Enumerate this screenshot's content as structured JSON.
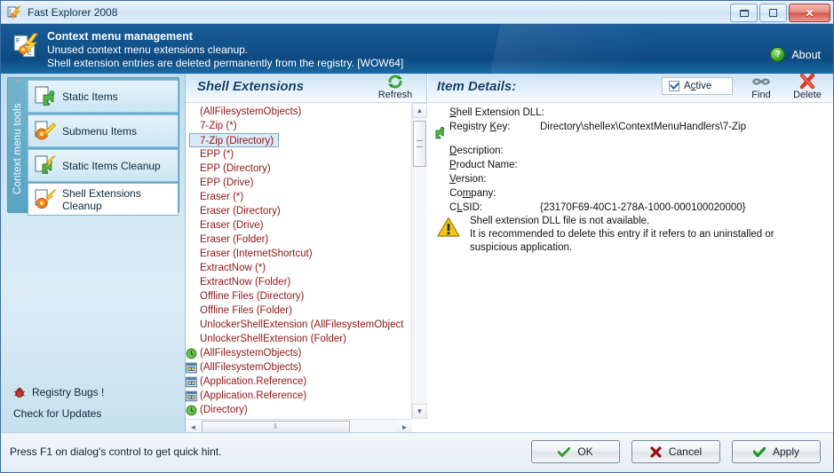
{
  "window": {
    "title": "Fast Explorer 2008",
    "app_icon": "lightning-app-icon",
    "minimize_label": "Minimize",
    "maximize_label": "Maximize",
    "close_label": "Close"
  },
  "banner": {
    "heading": "Context menu management",
    "line2": "Unused context menu extensions cleanup.",
    "line3": "Shell extension entries are deleted permanently from the registry. [WOW64]",
    "about_label": "About",
    "about_icon": "question-mark-icon"
  },
  "sidebar": {
    "group_label": "Context menu tools",
    "collapse_icon": "chevron-up-icon",
    "items": [
      {
        "label": "Static Items",
        "icon": "green-puzzle-icon",
        "selected": false
      },
      {
        "label": "Submenu Items",
        "icon": "orange-gear-wand-icon",
        "selected": false
      },
      {
        "label": "Static Items Cleanup",
        "icon": "green-puzzle-bolt-icon",
        "selected": false
      },
      {
        "label": "Shell Extensions Cleanup",
        "icon": "gear-bolt-icon",
        "selected": true
      }
    ],
    "registry_bugs_label": "Registry Bugs !",
    "registry_bugs_icon": "bug-icon",
    "check_updates_label": "Check for Updates"
  },
  "list_panel": {
    "title": "Shell Extensions",
    "refresh_label": "Refresh",
    "refresh_icon": "refresh-arrows-icon",
    "items": [
      {
        "label": "(AllFilesystemObjects)",
        "icon": null,
        "selected": false
      },
      {
        "label": "7-Zip (*)",
        "icon": null,
        "selected": false
      },
      {
        "label": "7-Zip (Directory)",
        "icon": null,
        "selected": true
      },
      {
        "label": "EPP (*)",
        "icon": null,
        "selected": false
      },
      {
        "label": "EPP (Directory)",
        "icon": null,
        "selected": false
      },
      {
        "label": "EPP (Drive)",
        "icon": null,
        "selected": false
      },
      {
        "label": "Eraser (*)",
        "icon": null,
        "selected": false
      },
      {
        "label": "Eraser (Directory)",
        "icon": null,
        "selected": false
      },
      {
        "label": "Eraser (Drive)",
        "icon": null,
        "selected": false
      },
      {
        "label": "Eraser (Folder)",
        "icon": null,
        "selected": false
      },
      {
        "label": "Eraser (InternetShortcut)",
        "icon": null,
        "selected": false
      },
      {
        "label": "ExtractNow (*)",
        "icon": null,
        "selected": false
      },
      {
        "label": "ExtractNow (Folder)",
        "icon": null,
        "selected": false
      },
      {
        "label": "Offline Files (Directory)",
        "icon": null,
        "selected": false
      },
      {
        "label": "Offline Files (Folder)",
        "icon": null,
        "selected": false
      },
      {
        "label": "UnlockerShellExtension (AllFilesystemObject",
        "icon": null,
        "selected": false
      },
      {
        "label": "UnlockerShellExtension (Folder)",
        "icon": null,
        "selected": false
      },
      {
        "label": "(AllFilesystemObjects)",
        "icon": "green-clock-icon",
        "selected": false
      },
      {
        "label": "(AllFilesystemObjects)",
        "icon": "blue-window-icon",
        "selected": false
      },
      {
        "label": "(Application.Reference)",
        "icon": "blue-window-icon",
        "selected": false
      },
      {
        "label": "(Application.Reference)",
        "icon": "blue-window-icon",
        "selected": false
      },
      {
        "label": "(Directory)",
        "icon": "green-clock-icon",
        "selected": false
      }
    ],
    "vscroll_up_icon": "triangle-up-icon",
    "vscroll_down_icon": "triangle-down-icon",
    "hscroll_left_icon": "triangle-left-icon",
    "hscroll_right_icon": "triangle-right-icon"
  },
  "details": {
    "title": "Item Details:",
    "active_label": "Active",
    "active_checked": true,
    "find_label": "Find",
    "find_icon": "binoculars-icon",
    "delete_label": "Delete",
    "delete_icon": "red-x-icon",
    "item_icon": "green-puzzle-icon",
    "fields": [
      {
        "label": "Shell Extension DLL:",
        "accel": "S",
        "value": ""
      },
      {
        "label": "Registry Key:",
        "accel": "K",
        "value": "Directory\\shellex\\ContextMenuHandlers\\7-Zip"
      },
      {
        "label": "Description:",
        "accel": "D",
        "value": ""
      },
      {
        "label": "Product Name:",
        "accel": "P",
        "value": ""
      },
      {
        "label": "Version:",
        "accel": "V",
        "value": ""
      },
      {
        "label": "Company:",
        "accel": "m",
        "value": ""
      },
      {
        "label": "CLSID:",
        "accel": "L",
        "value": "{23170F69-40C1-278A-1000-000100020000}"
      }
    ],
    "warning_icon": "warning-triangle-icon",
    "warning_line1": "Shell extension DLL file is not available.",
    "warning_line2": "It is recommended to delete this entry if it refers to an uninstalled or",
    "warning_line3": "suspicious application."
  },
  "footer": {
    "hint": "Press F1 on dialog's control to get quick hint.",
    "ok_label": "OK",
    "ok_icon": "green-check-icon",
    "cancel_label": "Cancel",
    "cancel_icon": "red-x-icon",
    "apply_label": "Apply",
    "apply_icon": "green-check-icon"
  },
  "colors": {
    "banner_blue": "#13538c",
    "accent_teal": "#59a3c3",
    "list_text_red": "#8f1616",
    "panel_title_blue": "#12406e"
  }
}
